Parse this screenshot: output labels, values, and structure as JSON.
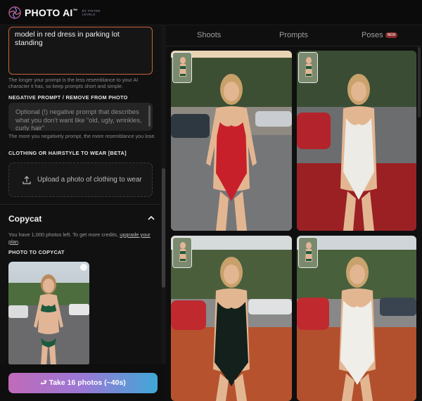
{
  "header": {
    "brand": "PHOTO AI",
    "trademark": "™",
    "tagline": "BY PIETER LEVELS"
  },
  "left": {
    "prompt_value": "model in red dress in parking lot standing",
    "prompt_hint": "The longer your prompt is the less resemblance to your AI character it has, so keep prompts short and simple.",
    "negative_label": "NEGATIVE PROMPT / REMOVE FROM PHOTO",
    "negative_placeholder": "Optional (!) negative prompt that describes what you don't want like \"old, ugly, wrinkles, curly hair\"",
    "negative_hint": "The more you negatively prompt, the more resemblance you lose.",
    "clothing_label": "CLOTHING OR HAIRSTYLE TO WEAR [BETA]",
    "upload_label": "Upload a photo of clothing to wear",
    "copycat_title": "Copycat",
    "credits_text": "You have 1,000 photos left. To get more credits,",
    "credits_link": "upgrade your plan",
    "credits_end": ".",
    "photo_to_copy_label": "PHOTO TO COPYCAT",
    "cta_label": "⮐ Take 16 photos (~40s)"
  },
  "tabs": [
    {
      "label": "Shoots"
    },
    {
      "label": "Prompts"
    },
    {
      "label": "Poses",
      "badge": "NEW"
    }
  ],
  "gallery": [
    {
      "dress": "red bodysuit",
      "color": "#c8202a"
    },
    {
      "dress": "white bodysuit",
      "color": "#ecebe6"
    },
    {
      "dress": "black bodysuit",
      "color": "#13201c"
    },
    {
      "dress": "white bodysuit",
      "color": "#efeee9"
    }
  ],
  "colors": {
    "accent_border": "#c7633a",
    "cta_gradient_start": "#c06bb9",
    "cta_gradient_end": "#3fa8d6",
    "new_badge": "#8a2b2b"
  }
}
